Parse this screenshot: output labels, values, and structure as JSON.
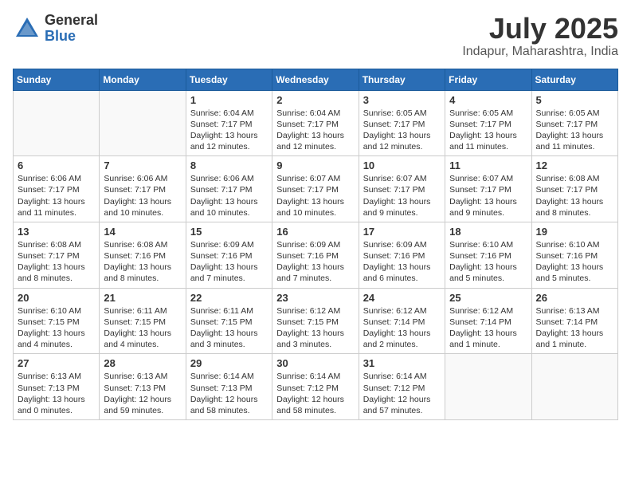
{
  "header": {
    "logo_general": "General",
    "logo_blue": "Blue",
    "month": "July 2025",
    "location": "Indapur, Maharashtra, India"
  },
  "weekdays": [
    "Sunday",
    "Monday",
    "Tuesday",
    "Wednesday",
    "Thursday",
    "Friday",
    "Saturday"
  ],
  "weeks": [
    [
      {
        "day": "",
        "info": ""
      },
      {
        "day": "",
        "info": ""
      },
      {
        "day": "1",
        "info": "Sunrise: 6:04 AM\nSunset: 7:17 PM\nDaylight: 13 hours\nand 12 minutes."
      },
      {
        "day": "2",
        "info": "Sunrise: 6:04 AM\nSunset: 7:17 PM\nDaylight: 13 hours\nand 12 minutes."
      },
      {
        "day": "3",
        "info": "Sunrise: 6:05 AM\nSunset: 7:17 PM\nDaylight: 13 hours\nand 12 minutes."
      },
      {
        "day": "4",
        "info": "Sunrise: 6:05 AM\nSunset: 7:17 PM\nDaylight: 13 hours\nand 11 minutes."
      },
      {
        "day": "5",
        "info": "Sunrise: 6:05 AM\nSunset: 7:17 PM\nDaylight: 13 hours\nand 11 minutes."
      }
    ],
    [
      {
        "day": "6",
        "info": "Sunrise: 6:06 AM\nSunset: 7:17 PM\nDaylight: 13 hours\nand 11 minutes."
      },
      {
        "day": "7",
        "info": "Sunrise: 6:06 AM\nSunset: 7:17 PM\nDaylight: 13 hours\nand 10 minutes."
      },
      {
        "day": "8",
        "info": "Sunrise: 6:06 AM\nSunset: 7:17 PM\nDaylight: 13 hours\nand 10 minutes."
      },
      {
        "day": "9",
        "info": "Sunrise: 6:07 AM\nSunset: 7:17 PM\nDaylight: 13 hours\nand 10 minutes."
      },
      {
        "day": "10",
        "info": "Sunrise: 6:07 AM\nSunset: 7:17 PM\nDaylight: 13 hours\nand 9 minutes."
      },
      {
        "day": "11",
        "info": "Sunrise: 6:07 AM\nSunset: 7:17 PM\nDaylight: 13 hours\nand 9 minutes."
      },
      {
        "day": "12",
        "info": "Sunrise: 6:08 AM\nSunset: 7:17 PM\nDaylight: 13 hours\nand 8 minutes."
      }
    ],
    [
      {
        "day": "13",
        "info": "Sunrise: 6:08 AM\nSunset: 7:17 PM\nDaylight: 13 hours\nand 8 minutes."
      },
      {
        "day": "14",
        "info": "Sunrise: 6:08 AM\nSunset: 7:16 PM\nDaylight: 13 hours\nand 8 minutes."
      },
      {
        "day": "15",
        "info": "Sunrise: 6:09 AM\nSunset: 7:16 PM\nDaylight: 13 hours\nand 7 minutes."
      },
      {
        "day": "16",
        "info": "Sunrise: 6:09 AM\nSunset: 7:16 PM\nDaylight: 13 hours\nand 7 minutes."
      },
      {
        "day": "17",
        "info": "Sunrise: 6:09 AM\nSunset: 7:16 PM\nDaylight: 13 hours\nand 6 minutes."
      },
      {
        "day": "18",
        "info": "Sunrise: 6:10 AM\nSunset: 7:16 PM\nDaylight: 13 hours\nand 5 minutes."
      },
      {
        "day": "19",
        "info": "Sunrise: 6:10 AM\nSunset: 7:16 PM\nDaylight: 13 hours\nand 5 minutes."
      }
    ],
    [
      {
        "day": "20",
        "info": "Sunrise: 6:10 AM\nSunset: 7:15 PM\nDaylight: 13 hours\nand 4 minutes."
      },
      {
        "day": "21",
        "info": "Sunrise: 6:11 AM\nSunset: 7:15 PM\nDaylight: 13 hours\nand 4 minutes."
      },
      {
        "day": "22",
        "info": "Sunrise: 6:11 AM\nSunset: 7:15 PM\nDaylight: 13 hours\nand 3 minutes."
      },
      {
        "day": "23",
        "info": "Sunrise: 6:12 AM\nSunset: 7:15 PM\nDaylight: 13 hours\nand 3 minutes."
      },
      {
        "day": "24",
        "info": "Sunrise: 6:12 AM\nSunset: 7:14 PM\nDaylight: 13 hours\nand 2 minutes."
      },
      {
        "day": "25",
        "info": "Sunrise: 6:12 AM\nSunset: 7:14 PM\nDaylight: 13 hours\nand 1 minute."
      },
      {
        "day": "26",
        "info": "Sunrise: 6:13 AM\nSunset: 7:14 PM\nDaylight: 13 hours\nand 1 minute."
      }
    ],
    [
      {
        "day": "27",
        "info": "Sunrise: 6:13 AM\nSunset: 7:13 PM\nDaylight: 13 hours\nand 0 minutes."
      },
      {
        "day": "28",
        "info": "Sunrise: 6:13 AM\nSunset: 7:13 PM\nDaylight: 12 hours\nand 59 minutes."
      },
      {
        "day": "29",
        "info": "Sunrise: 6:14 AM\nSunset: 7:13 PM\nDaylight: 12 hours\nand 58 minutes."
      },
      {
        "day": "30",
        "info": "Sunrise: 6:14 AM\nSunset: 7:12 PM\nDaylight: 12 hours\nand 58 minutes."
      },
      {
        "day": "31",
        "info": "Sunrise: 6:14 AM\nSunset: 7:12 PM\nDaylight: 12 hours\nand 57 minutes."
      },
      {
        "day": "",
        "info": ""
      },
      {
        "day": "",
        "info": ""
      }
    ]
  ]
}
